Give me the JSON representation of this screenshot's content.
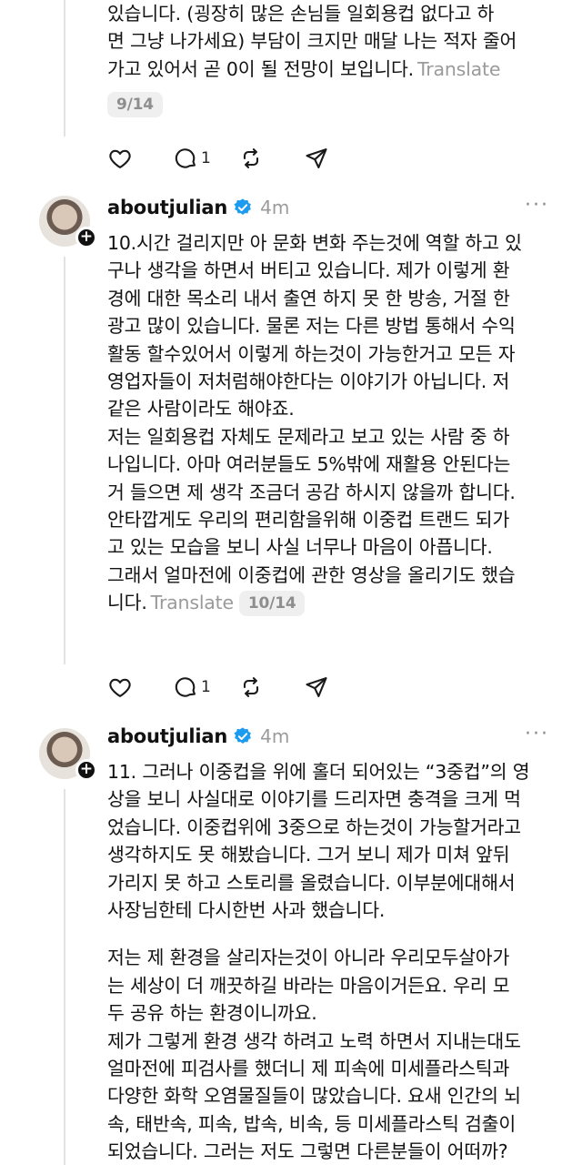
{
  "posts": [
    {
      "username": "",
      "time": "",
      "paragraphs": [
        "있습니다. (굉장히 많은 손님들 일회용컵 없다고 하\n면 그냥 나가세요) 부담이 크지만 매달 나는 적자 줄어\n가고 있어서 곧 0이 될 전망이 보입니다."
      ],
      "translate": "Translate",
      "counter": "9/14",
      "reply_count": "1"
    },
    {
      "username": "aboutjulian",
      "time": "4m",
      "paragraphs": [
        "10.시간 걸리지만 아 문화 변화 주는것에 역할 하고 있\n구나 생각을 하면서 버티고 있습니다. 제가 이렇게 환\n경에 대한 목소리 내서 출연 하지 못 한 방송, 거절 한\n광고 많이 있습니다. 물론 저는 다른 방법 통해서 수익\n활동 할수있어서 이렇게 하는것이 가능한거고 모든 자\n영업자들이 저처럼해야한다는 이야기가 아닙니다. 저\n같은 사람이라도 해야죠.",
        "저는 일회용컵 자체도 문제라고 보고 있는 사람 중 하\n나입니다. 아마 여러분들도 5%밖에 재활용 안된다는\n거 들으면 제 생각 조금더 공감 하시지 않을까 합니다.\n안타깝게도 우리의 편리함을위해 이중컵 트랜드 되가\n고 있는 모습을 보니 사실 너무나 마음이 아픕니다.\n그래서 얼마전에 이중컵에 관한 영상을 올리기도 했습\n니다."
      ],
      "translate": "Translate",
      "counter": "10/14",
      "reply_count": "1"
    },
    {
      "username": "aboutjulian",
      "time": "4m",
      "paragraphs": [
        "11. 그러나 이중컵을 위에 홀더 되어있는 “3중컵”의 영\n상을 보니 사실대로 이야기를 드리자면 충격을 크게 먹\n었습니다. 이중컵위에 3중으로 하는것이 가능할거라고\n생각하지도 못 해봤습니다. 그거 보니 제가 미쳐 앞뒤\n가리지 못 하고 스토리를 올렸습니다. 이부분에대해서\n사장님한테 다시한번 사과 했습니다.",
        "저는 제 환경을 살리자는것이 아니라 우리모두살아가\n는 세상이 더 깨끗하길 바라는 마음이거든요. 우리 모\n두 공유 하는 환경이니까요.\n제가 그렇게 환경 생각 하려고 노력 하면서 지내는대도\n얼마전에 피검사를 했더니 제 피속에 미세플라스틱과\n다양한 화학 오염물질들이 많았습니다. 요새 인간의 뇌\n속, 태반속, 피속, 밥속, 비속, 등 미세플라스틱 검출이\n되었습니다. 그러는 저도 그렇면 다른분들이 어떠까?"
      ]
    }
  ],
  "icons": {
    "like": "heart-icon",
    "reply": "comment-icon",
    "repost": "repost-icon",
    "share": "send-icon",
    "verified": "verified-badge-icon",
    "more": "more-icon"
  },
  "colors": {
    "verified": "#1d9bf0",
    "muted": "#9b9b9b"
  }
}
